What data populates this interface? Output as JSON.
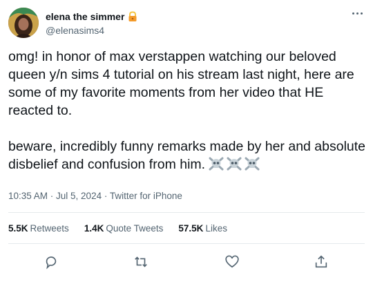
{
  "user": {
    "display_name": "elena the simmer",
    "handle": "@elenasims4"
  },
  "tweet": {
    "text": "omg! in honor of max verstappen watching our beloved queen y/n sims 4 tutorial on his stream last night, here are some of my favorite moments from her video that HE reacted to.\n\nbeware, incredibly funny remarks made by her and absolute disbelief and confusion from him.",
    "timestamp": "10:35 AM · Jul 5, 2024 · Twitter for iPhone"
  },
  "stats": {
    "retweets_count": "5.5K",
    "retweets_label": "Retweets",
    "quotes_count": "1.4K",
    "quotes_label": "Quote Tweets",
    "likes_count": "57.5K",
    "likes_label": "Likes"
  },
  "icons": {
    "lock": "locked-padlock-emoji",
    "skull": "skull-and-crossbones-emoji",
    "reply": "reply-icon",
    "retweet": "retweet-icon",
    "like": "heart-icon",
    "share": "share-icon",
    "more": "more-icon"
  },
  "colors": {
    "text": "#0f1419",
    "secondary": "#536471",
    "divider": "#e5eaec"
  }
}
